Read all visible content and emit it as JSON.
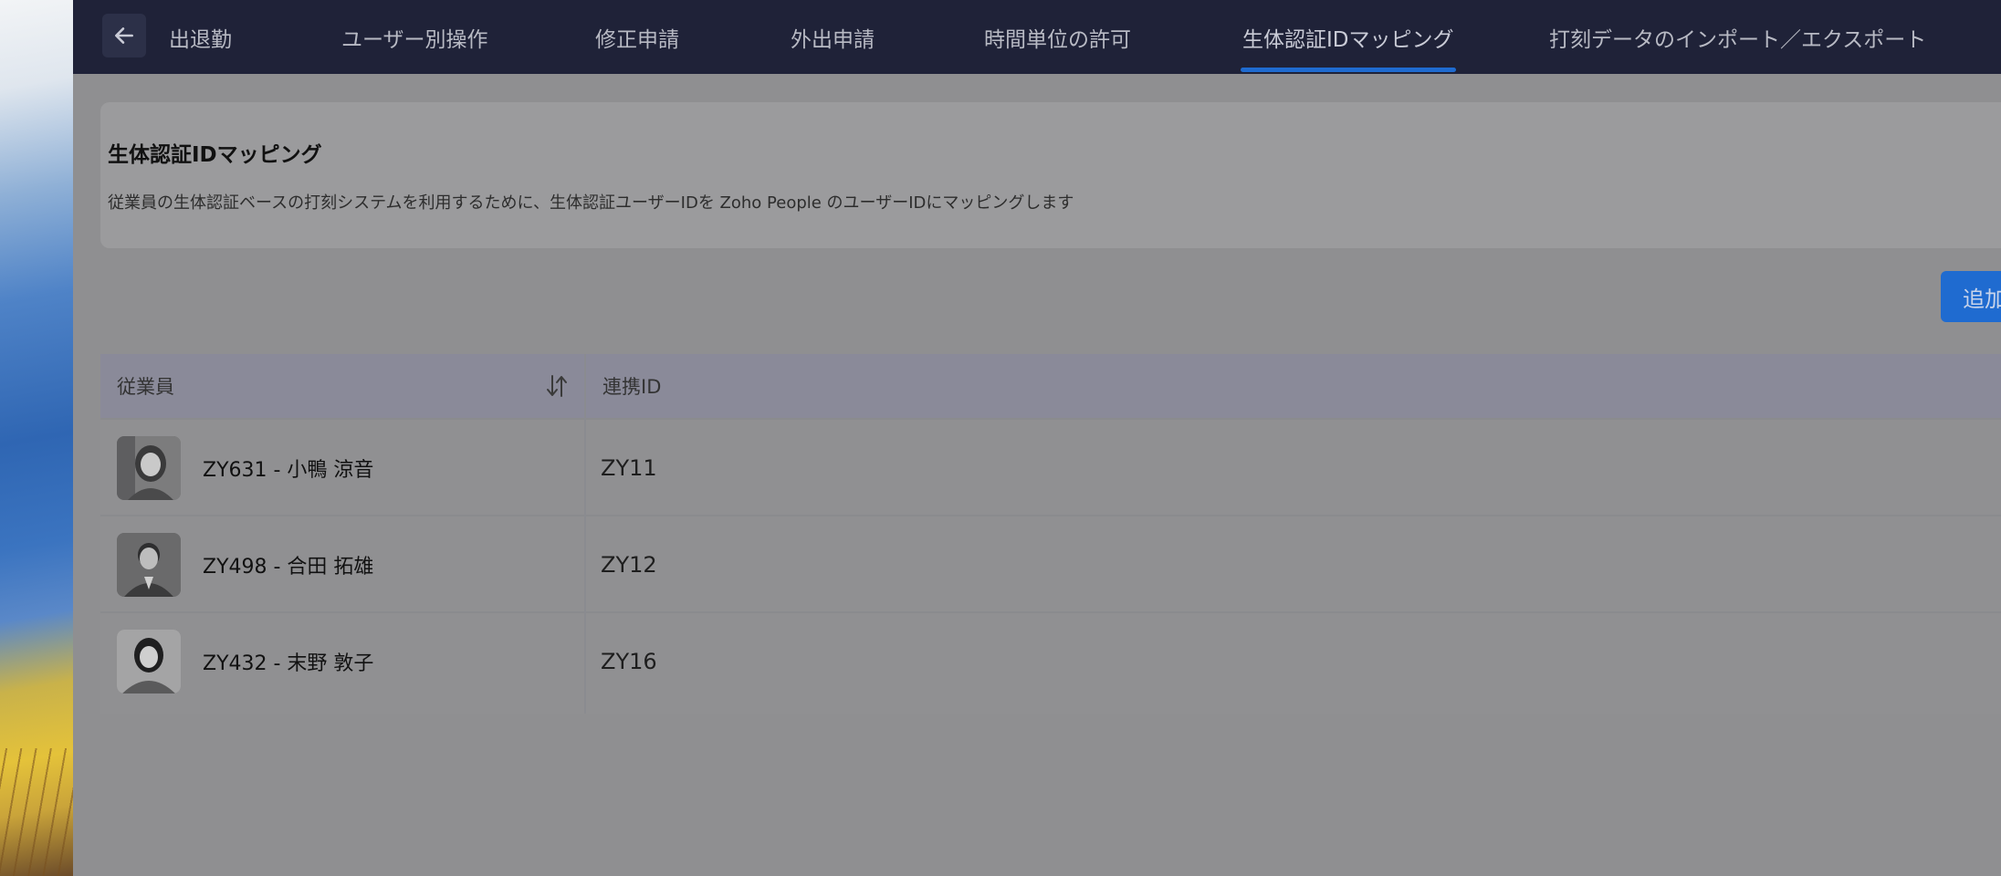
{
  "nav": {
    "tabs": [
      {
        "label": "出退勤"
      },
      {
        "label": "ユーザー別操作"
      },
      {
        "label": "修正申請"
      },
      {
        "label": "外出申請"
      },
      {
        "label": "時間単位の許可"
      },
      {
        "label": "生体認証IDマッピング"
      },
      {
        "label": "打刻データのインポート／エクスポート"
      }
    ],
    "active_tab": "生体認証IDマッピング"
  },
  "card": {
    "title": "生体認証IDマッピング",
    "description": "従業員の生体認証ベースの打刻システムを利用するために、生体認証ユーザーIDを Zoho People のユーザーIDにマッピングします"
  },
  "toolbar": {
    "add_label": "追加"
  },
  "table": {
    "headers": {
      "employee": "従業員",
      "link_id": "連携ID"
    },
    "rows": [
      {
        "employee": "ZY631 - 小鴨 涼音",
        "link_id": "ZY11"
      },
      {
        "employee": "ZY498 - 合田 拓雄",
        "link_id": "ZY12"
      },
      {
        "employee": "ZY432 - 末野 敦子",
        "link_id": "ZY16"
      }
    ]
  },
  "colors": {
    "nav_bg": "#1f2238",
    "accent": "#1f6bd0",
    "overlay": "#8f8f91"
  },
  "icons": {
    "back": "arrow-left-icon",
    "sort": "sort-icon"
  }
}
